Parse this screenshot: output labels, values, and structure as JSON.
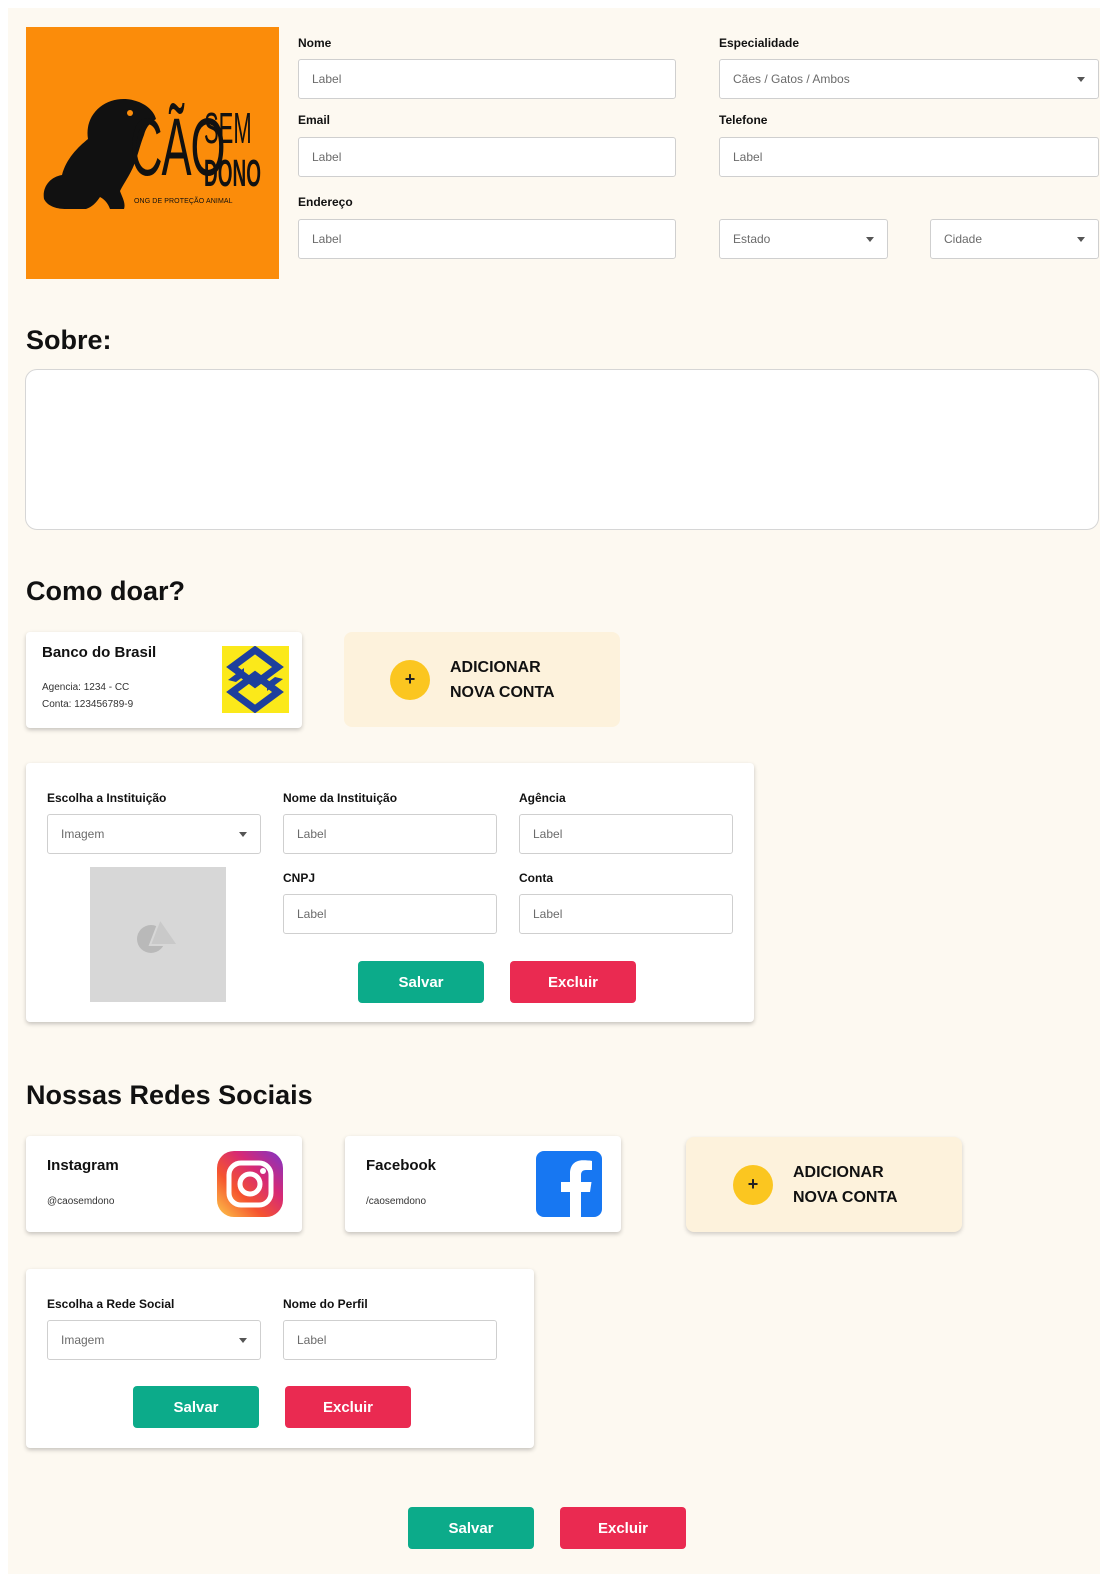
{
  "logo": {
    "brand_main": "CÃO",
    "brand_sem": "SEM",
    "brand_dono": "DONO",
    "tagline": "ONG DE PROTEÇÃO ANIMAL"
  },
  "profile": {
    "nome_label": "Nome",
    "nome_value": "Label",
    "especialidade_label": "Especialidade",
    "especialidade_value": "Cães / Gatos / Ambos",
    "email_label": "Email",
    "email_value": "Label",
    "telefone_label": "Telefone",
    "telefone_value": "Label",
    "endereco_label": "Endereço",
    "endereco_value": "Label",
    "estado_value": "Estado",
    "cidade_value": "Cidade"
  },
  "sobre": {
    "title": "Sobre:"
  },
  "doar": {
    "title": "Como doar?",
    "bank_card": {
      "name": "Banco do Brasil",
      "agencia": "Agencia: 1234 - CC",
      "conta": "Conta: 123456789-9"
    },
    "add_account": {
      "line1": "ADICIONAR",
      "line2": "NOVA CONTA"
    },
    "form": {
      "instituicao_label": "Escolha a Instituição",
      "instituicao_value": "Imagem",
      "nome_label": "Nome da Instituição",
      "nome_value": "Label",
      "agencia_label": "Agência",
      "agencia_value": "Label",
      "cnpj_label": "CNPJ",
      "cnpj_value": "Label",
      "conta_label": "Conta",
      "conta_value": "Label",
      "save": "Salvar",
      "delete": "Excluir"
    }
  },
  "redes": {
    "title": "Nossas Redes Sociais",
    "instagram": {
      "name": "Instagram",
      "handle": "@caosemdono"
    },
    "facebook": {
      "name": "Facebook",
      "handle": "/caosemdono"
    },
    "add_account": {
      "line1": "ADICIONAR",
      "line2": "NOVA CONTA"
    },
    "form": {
      "rede_label": "Escolha a Rede Social",
      "rede_value": "Imagem",
      "perfil_label": "Nome do Perfil",
      "perfil_value": "Label",
      "save": "Salvar",
      "delete": "Excluir"
    }
  },
  "footer": {
    "save": "Salvar",
    "delete": "Excluir"
  },
  "colors": {
    "background": "#fdf9f1",
    "logo_orange": "#fb8c0a",
    "green": "#0cab8a",
    "red": "#ea2a51",
    "yellow_plus": "#fbc620",
    "add_card_bg": "#fdf2dc"
  },
  "icons": {
    "logo": "dog-silhouette-icon",
    "select_caret": "caret-down-icon",
    "bank": "banco-do-brasil-icon",
    "add": "plus-icon",
    "image_placeholder": "image-placeholder-icon",
    "instagram": "instagram-icon",
    "facebook": "facebook-icon"
  }
}
